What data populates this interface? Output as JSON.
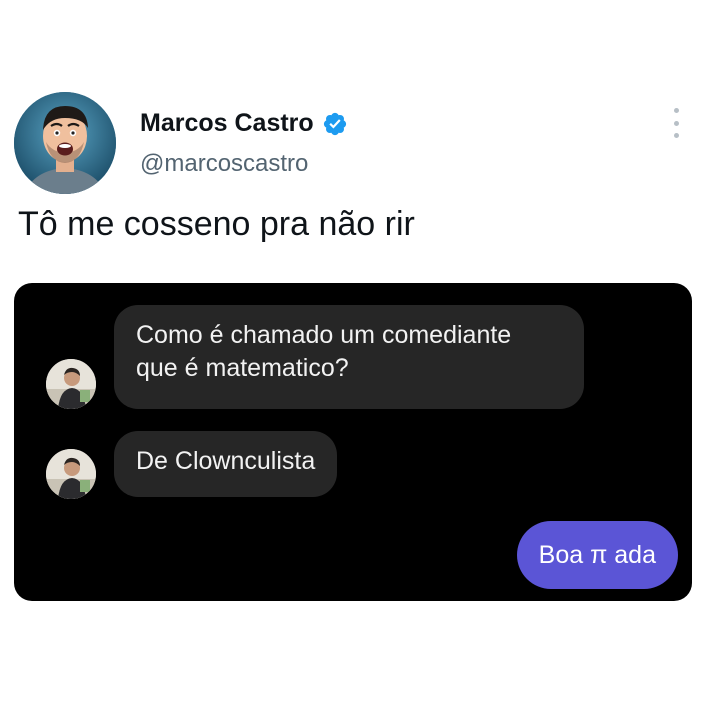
{
  "tweet": {
    "display_name": "Marcos Castro",
    "handle": "@marcoscastro",
    "text": "Tô me cosseno pra não rir",
    "verified_icon": "verified-badge-icon",
    "more_icon": "more-options-icon",
    "colors": {
      "verified": "#1d9bf0",
      "name": "#0f1419",
      "handle": "#536471"
    }
  },
  "chat": {
    "background": "#000000",
    "messages": [
      {
        "direction": "incoming",
        "lines": [
          "Como é chamado um comediante",
          "que é matematico?"
        ]
      },
      {
        "direction": "incoming",
        "lines": [
          "De Clownculista"
        ]
      },
      {
        "direction": "outgoing",
        "lines": [
          "Boa π ada"
        ]
      }
    ],
    "colors": {
      "incoming_bubble": "#262626",
      "outgoing_bubble": "#5b55d6"
    }
  }
}
